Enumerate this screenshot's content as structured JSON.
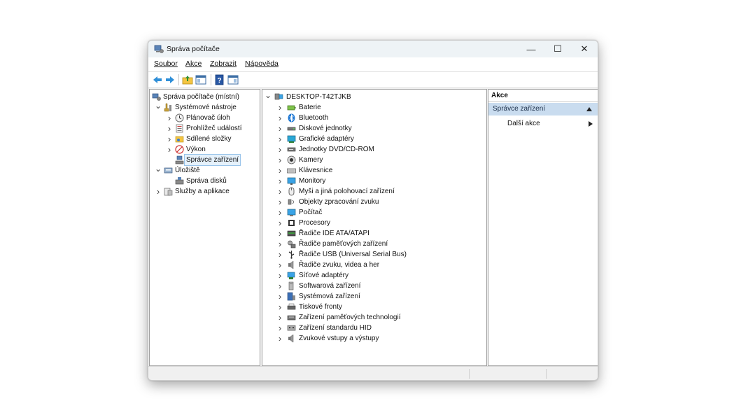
{
  "window": {
    "title": "Správa počítače",
    "minimize": "—",
    "maximize": "☐",
    "close": "✕"
  },
  "menu": [
    "Soubor",
    "Akce",
    "Zobrazit",
    "Nápověda"
  ],
  "toolbar": {
    "icons": [
      "back-arrow-icon",
      "forward-arrow-icon",
      "up-folder-icon",
      "show-hide-tree-icon",
      "help-icon",
      "show-action-pane-icon"
    ]
  },
  "left_tree": [
    {
      "label": "Správa počítače (místní)",
      "level": 0,
      "expander": "",
      "icon": "computer-management-icon"
    },
    {
      "label": "Systémové nástroje",
      "level": 1,
      "expander": "v",
      "icon": "tools-icon"
    },
    {
      "label": "Plánovač úloh",
      "level": 2,
      "expander": ">",
      "icon": "clock-icon"
    },
    {
      "label": "Prohlížeč událostí",
      "level": 2,
      "expander": ">",
      "icon": "event-viewer-icon"
    },
    {
      "label": "Sdílené složky",
      "level": 2,
      "expander": ">",
      "icon": "shared-folder-icon"
    },
    {
      "label": "Výkon",
      "level": 2,
      "expander": ">",
      "icon": "performance-icon"
    },
    {
      "label": "Správce zařízení",
      "level": 2,
      "expander": "",
      "icon": "device-manager-icon",
      "selected": true
    },
    {
      "label": "Úložiště",
      "level": 1,
      "expander": "v",
      "icon": "storage-icon"
    },
    {
      "label": "Správa disků",
      "level": 2,
      "expander": "",
      "icon": "disk-management-icon"
    },
    {
      "label": "Služby a aplikace",
      "level": 1,
      "expander": ">",
      "icon": "services-icon"
    }
  ],
  "device_tree": {
    "root": "DESKTOP-T42TJKB",
    "categories": [
      {
        "label": "Baterie",
        "icon": "battery-icon"
      },
      {
        "label": "Bluetooth",
        "icon": "bluetooth-icon"
      },
      {
        "label": "Diskové jednotky",
        "icon": "disk-drive-icon"
      },
      {
        "label": "Grafické adaptéry",
        "icon": "display-adapter-icon"
      },
      {
        "label": "Jednotky DVD/CD-ROM",
        "icon": "dvd-drive-icon"
      },
      {
        "label": "Kamery",
        "icon": "camera-icon"
      },
      {
        "label": "Klávesnice",
        "icon": "keyboard-icon"
      },
      {
        "label": "Monitory",
        "icon": "monitor-icon"
      },
      {
        "label": "Myši a jiná polohovací zařízení",
        "icon": "mouse-icon"
      },
      {
        "label": "Objekty zpracování zvuku",
        "icon": "audio-processing-icon"
      },
      {
        "label": "Počítač",
        "icon": "computer-icon"
      },
      {
        "label": "Procesory",
        "icon": "processor-icon"
      },
      {
        "label": "Řadiče IDE ATA/ATAPI",
        "icon": "ide-controller-icon"
      },
      {
        "label": "Řadiče paměťových zařízení",
        "icon": "storage-controller-icon"
      },
      {
        "label": "Řadiče USB (Universal Serial Bus)",
        "icon": "usb-icon"
      },
      {
        "label": "Řadiče zvuku, videa a her",
        "icon": "sound-icon"
      },
      {
        "label": "Síťové adaptéry",
        "icon": "network-adapter-icon"
      },
      {
        "label": "Softwarová zařízení",
        "icon": "software-device-icon"
      },
      {
        "label": "Systémová zařízení",
        "icon": "system-device-icon"
      },
      {
        "label": "Tiskové fronty",
        "icon": "printer-icon"
      },
      {
        "label": "Zařízení paměťových technologií",
        "icon": "memory-tech-icon"
      },
      {
        "label": "Zařízení standardu HID",
        "icon": "hid-icon"
      },
      {
        "label": "Zvukové vstupy a výstupy",
        "icon": "audio-io-icon"
      }
    ]
  },
  "actions": {
    "title": "Akce",
    "section": "Správce zařízení",
    "more": "Další akce"
  },
  "colors": {
    "selection": "#e5f1fb",
    "action_section": "#c9dcef",
    "accent": "#1e78d4"
  }
}
